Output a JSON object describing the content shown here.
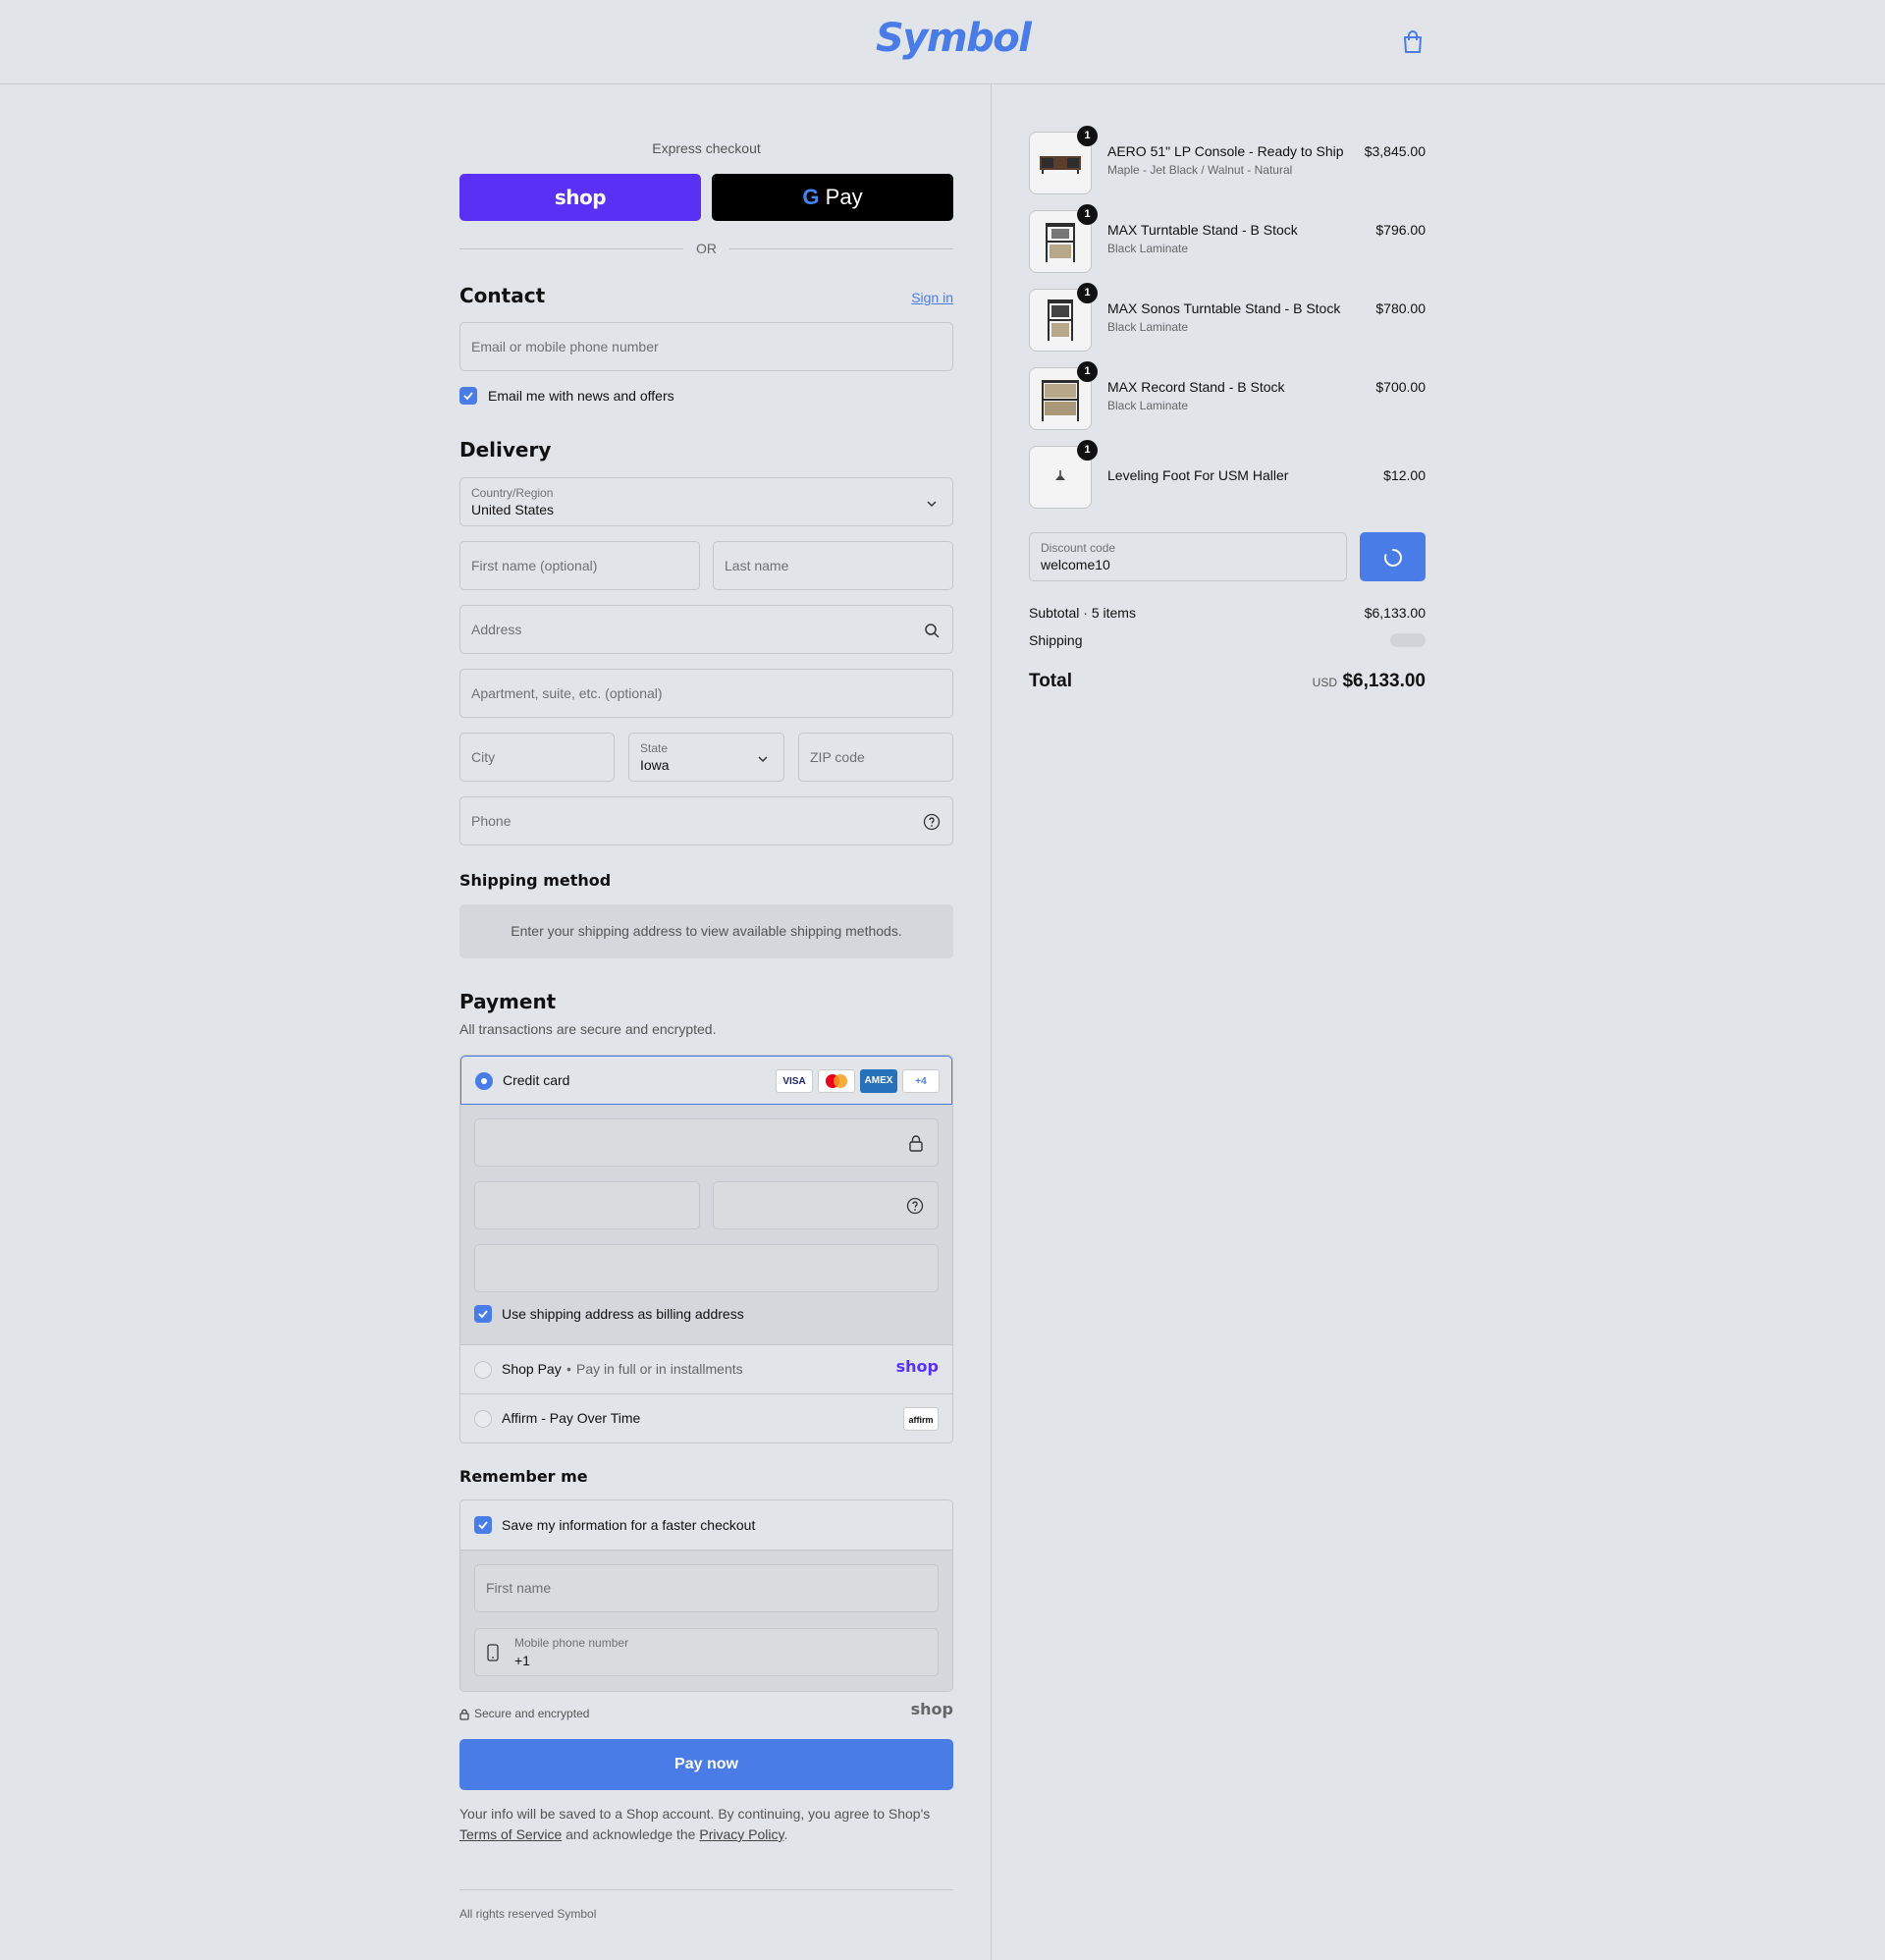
{
  "header": {
    "brand": "Symbol",
    "cart_icon": "bag-icon"
  },
  "express": {
    "label": "Express checkout",
    "shop_pay": "shop",
    "gpay_g": "G",
    "gpay_label": "Pay",
    "or": "OR"
  },
  "contact": {
    "title": "Contact",
    "sign_in": "Sign in",
    "email_placeholder": "Email or mobile phone number",
    "newsletter_label": "Email me with news and offers",
    "newsletter_checked": true
  },
  "delivery": {
    "title": "Delivery",
    "country_label": "Country/Region",
    "country_value": "United States",
    "first_name_placeholder": "First name (optional)",
    "last_name_placeholder": "Last name",
    "address_placeholder": "Address",
    "apartment_placeholder": "Apartment, suite, etc. (optional)",
    "city_placeholder": "City",
    "state_label": "State",
    "state_value": "Iowa",
    "zip_placeholder": "ZIP code",
    "phone_placeholder": "Phone"
  },
  "shipping_method": {
    "title": "Shipping method",
    "message": "Enter your shipping address to view available shipping methods."
  },
  "payment": {
    "title": "Payment",
    "subtitle": "All transactions are secure and encrypted.",
    "credit_card_label": "Credit card",
    "card_logos": [
      "VISA",
      "MC",
      "AMEX",
      "+4"
    ],
    "billing_same_label": "Use shipping address as billing address",
    "shop_pay_label": "Shop Pay",
    "shop_pay_sub": "Pay in full or in installments",
    "shop_pay_logo": "shop",
    "affirm_label": "Affirm - Pay Over Time",
    "affirm_logo": "affirm"
  },
  "remember": {
    "title": "Remember me",
    "save_label": "Save my information for a faster checkout",
    "first_name_placeholder": "First name",
    "mobile_label": "Mobile phone number",
    "mobile_value": "+1"
  },
  "secure": {
    "label": "Secure and encrypted",
    "shop_logo": "shop"
  },
  "pay_now": "Pay now",
  "legal": {
    "text1": "Your info will be saved to a Shop account. By continuing, you agree to Shop's",
    "terms": "Terms of Service",
    "text2": "and acknowledge the",
    "privacy": "Privacy Policy",
    "text3": "."
  },
  "footer": "All rights reserved Symbol",
  "cart": {
    "items": [
      {
        "name": "AERO 51\" LP Console - Ready to Ship",
        "variant": "Maple - Jet Black / Walnut - Natural",
        "price": "$3,845.00",
        "qty": "1"
      },
      {
        "name": "MAX Turntable Stand - B Stock",
        "variant": "Black Laminate",
        "price": "$796.00",
        "qty": "1"
      },
      {
        "name": "MAX Sonos Turntable Stand - B Stock",
        "variant": "Black Laminate",
        "price": "$780.00",
        "qty": "1"
      },
      {
        "name": "MAX Record Stand - B Stock",
        "variant": "Black Laminate",
        "price": "$700.00",
        "qty": "1"
      },
      {
        "name": "Leveling Foot For USM Haller",
        "variant": "",
        "price": "$12.00",
        "qty": "1"
      }
    ],
    "discount_label": "Discount code",
    "discount_value": "welcome10",
    "subtotal_label": "Subtotal · 5 items",
    "subtotal_value": "$6,133.00",
    "shipping_label": "Shipping",
    "total_label": "Total",
    "currency": "USD",
    "total_value": "$6,133.00"
  },
  "colors": {
    "accent": "#4a7ce8",
    "shop_purple": "#5a31f4",
    "background": "#e1e4e8"
  }
}
